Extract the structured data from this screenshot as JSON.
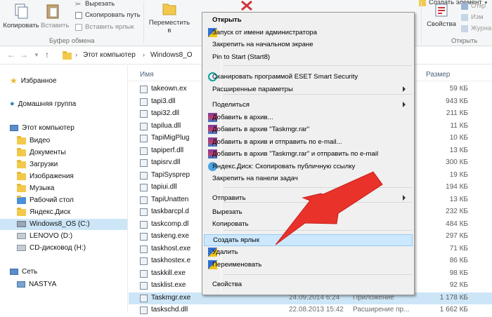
{
  "ribbon": {
    "copy": "Копировать",
    "paste": "Вставить",
    "cut": "Вырезать",
    "copy_path": "Скопировать путь",
    "paste_shortcut": "Вставить ярлык",
    "clipboard_group": "Буфер обмена",
    "move_to": "Переместить",
    "move_to_2": "в",
    "create_item": "Создать элемент",
    "properties": "Свойства",
    "open_group": "Открыть",
    "open_small": "Откр",
    "edit_small": "Изм",
    "history_small": "Журна"
  },
  "address": {
    "segments": [
      "Этот компьютер",
      "Windows8_O"
    ]
  },
  "nav": {
    "favorites": "Избранное",
    "homegroup": "Домашняя группа",
    "this_pc": "Этот компьютер",
    "items": [
      "Видео",
      "Документы",
      "Загрузки",
      "Изображения",
      "Музыка",
      "Рабочий стол",
      "Яндекс.Диск",
      "Windows8_OS (C:)",
      "LENOVO (D:)",
      "CD-дисковод (H:)"
    ],
    "network": "Сеть",
    "network_items": [
      "NASTYA"
    ]
  },
  "list": {
    "col_name": "Имя",
    "col_size": "Размер",
    "rows": [
      {
        "name": "takeown.ex",
        "size": "59 КБ"
      },
      {
        "name": "tapi3.dll",
        "size": "943 КБ"
      },
      {
        "name": "tapi32.dll",
        "size": "211 КБ"
      },
      {
        "name": "tapilua.dll",
        "size": "11 КБ"
      },
      {
        "name": "TapiMigPlug",
        "size": "10 КБ"
      },
      {
        "name": "tapiperf.dll",
        "size": "13 КБ"
      },
      {
        "name": "tapisrv.dll",
        "size": "300 КБ"
      },
      {
        "name": "TapiSysprep",
        "size": "19 КБ"
      },
      {
        "name": "tapiui.dll",
        "size": "194 КБ"
      },
      {
        "name": "TapiUnatten",
        "size": "13 КБ"
      },
      {
        "name": "taskbarcpl.d",
        "size": "232 КБ"
      },
      {
        "name": "taskcomp.dl",
        "size": "484 КБ"
      },
      {
        "name": "taskeng.exe",
        "size": "297 КБ"
      },
      {
        "name": "taskhost.exe",
        "size": "71 КБ"
      },
      {
        "name": "taskhostex.e",
        "size": "86 КБ"
      },
      {
        "name": "taskkill.exe",
        "size": "98 КБ"
      },
      {
        "name": "tasklist.exe",
        "size": "92 КБ"
      },
      {
        "name": "Taskmgr.exe",
        "date": "24.09.2014 6:24",
        "type": "Приложение",
        "size": "1 178 КБ"
      },
      {
        "name": "taskschd.dll",
        "date": "22.08.2013 15:42",
        "type": "Расширение пр...",
        "size": "1 662 КБ"
      }
    ]
  },
  "menu": {
    "items": [
      {
        "label": "Открыть",
        "bold": true
      },
      {
        "label": "Запуск от имени администратора"
      },
      {
        "label": "Закрепить на начальном экране"
      },
      {
        "label": "Pin to Start (Start8)"
      },
      {
        "label": "Сканировать программой ESET Smart Security"
      },
      {
        "label": "Расширенные параметры"
      },
      {
        "label": "Поделиться"
      },
      {
        "label": "Добавить в архив..."
      },
      {
        "label": "Добавить в архив \"Taskmgr.rar\""
      },
      {
        "label": "Добавить в архив и отправить по e-mail..."
      },
      {
        "label": "Добавить в архив \"Taskmgr.rar\" и отправить по e-mail"
      },
      {
        "label": "Яндекс.Диск: Скопировать публичную ссылку"
      },
      {
        "label": "Закрепить на панели задач"
      },
      {
        "label": "Отправить"
      },
      {
        "label": "Вырезать"
      },
      {
        "label": "Копировать"
      },
      {
        "label": "Создать ярлык"
      },
      {
        "label": "Удалить"
      },
      {
        "label": "Переименовать"
      },
      {
        "label": "Свойства"
      }
    ]
  },
  "colors": {
    "highlight": "#cce8ff",
    "arrow": "#e8322a",
    "selection": "#cde6f7"
  }
}
